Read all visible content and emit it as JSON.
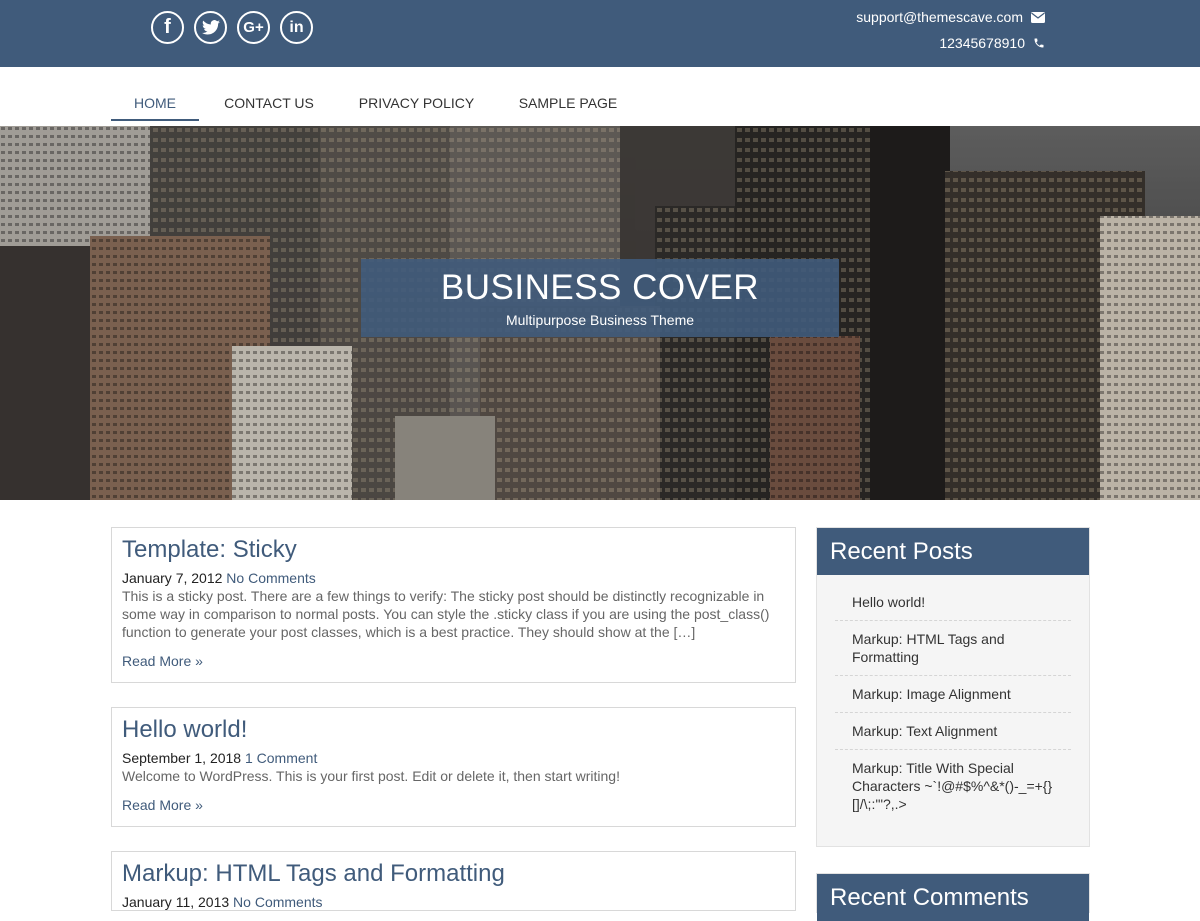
{
  "topbar": {
    "social": [
      "facebook-icon",
      "twitter-icon",
      "google-plus-icon",
      "linkedin-icon"
    ],
    "email": "support@themescave.com",
    "phone": "12345678910"
  },
  "nav": {
    "items": [
      "HOME",
      "CONTACT US",
      "PRIVACY POLICY",
      "SAMPLE PAGE"
    ],
    "active": "HOME"
  },
  "hero": {
    "title": "BUSINESS COVER",
    "subtitle": "Multipurpose Business Theme"
  },
  "posts": [
    {
      "title": "Template: Sticky",
      "date": "January 7, 2012",
      "comments": "No Comments",
      "excerpt": "This is a sticky post. There are a few things to verify: The sticky post should be distinctly recognizable in some way in comparison to normal posts. You can style the .sticky class if you are using the post_class() function to generate your post classes, which is a best practice. They should show at the […]",
      "read_more": "Read More »"
    },
    {
      "title": "Hello world!",
      "date": "September 1, 2018",
      "comments": "1 Comment",
      "excerpt": "Welcome to WordPress. This is your first post. Edit or delete it, then start writing!",
      "read_more": "Read More »"
    },
    {
      "title": "Markup: HTML Tags and Formatting",
      "date": "January 11, 2013",
      "comments": "No Comments"
    }
  ],
  "sidebar": {
    "recent_posts": {
      "title": "Recent Posts",
      "items": [
        "Hello world!",
        "Markup: HTML Tags and Formatting",
        "Markup: Image Alignment",
        "Markup: Text Alignment",
        "Markup: Title With Special Characters ~`!@#$%^&*()-_=+{}[]/\\;:'\"?,.>"
      ]
    },
    "recent_comments": {
      "title": "Recent Comments"
    }
  },
  "colors": {
    "brand": "#405b7b",
    "border": "#d8d8d8"
  }
}
